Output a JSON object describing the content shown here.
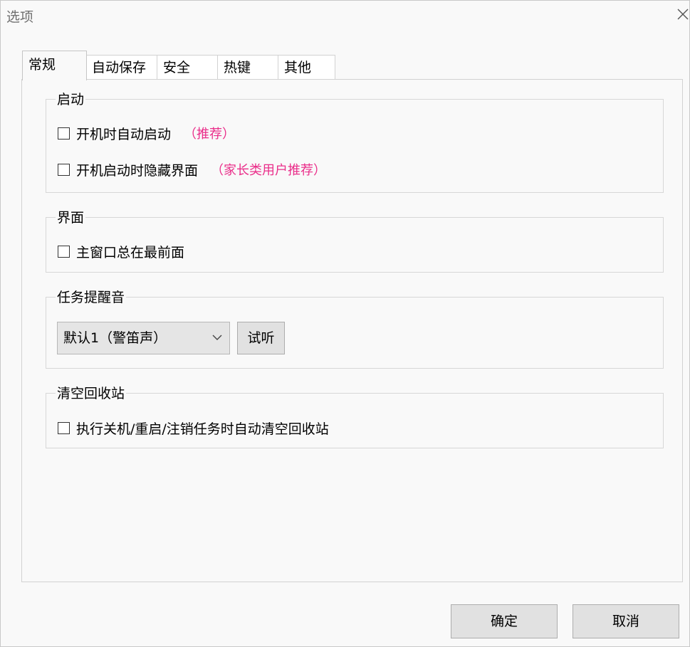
{
  "window": {
    "title": "选项"
  },
  "tabs": [
    {
      "label": "常规",
      "active": true
    },
    {
      "label": "自动保存",
      "active": false
    },
    {
      "label": "安全",
      "active": false
    },
    {
      "label": "热键",
      "active": false
    },
    {
      "label": "其他",
      "active": false
    }
  ],
  "groups": {
    "startup": {
      "title": "启动",
      "options": [
        {
          "label": "开机时自动启动",
          "hint": "（推荐）",
          "checked": false
        },
        {
          "label": "开机启动时隐藏界面",
          "hint": "（家长类用户推荐）",
          "checked": false
        }
      ]
    },
    "ui": {
      "title": "界面",
      "options": [
        {
          "label": "主窗口总在最前面",
          "checked": false
        }
      ]
    },
    "sound": {
      "title": "任务提醒音",
      "selected": "默认1（警笛声）",
      "test_label": "试听"
    },
    "recycle": {
      "title": "清空回收站",
      "options": [
        {
          "label": "执行关机/重启/注销任务时自动清空回收站",
          "checked": false
        }
      ]
    }
  },
  "footer": {
    "ok_label": "确定",
    "cancel_label": "取消"
  },
  "colors": {
    "hint": "#ea2e8a",
    "background": "#f9f9f9"
  },
  "icons": {
    "close": "close-icon",
    "dropdown": "chevron-down-icon"
  }
}
